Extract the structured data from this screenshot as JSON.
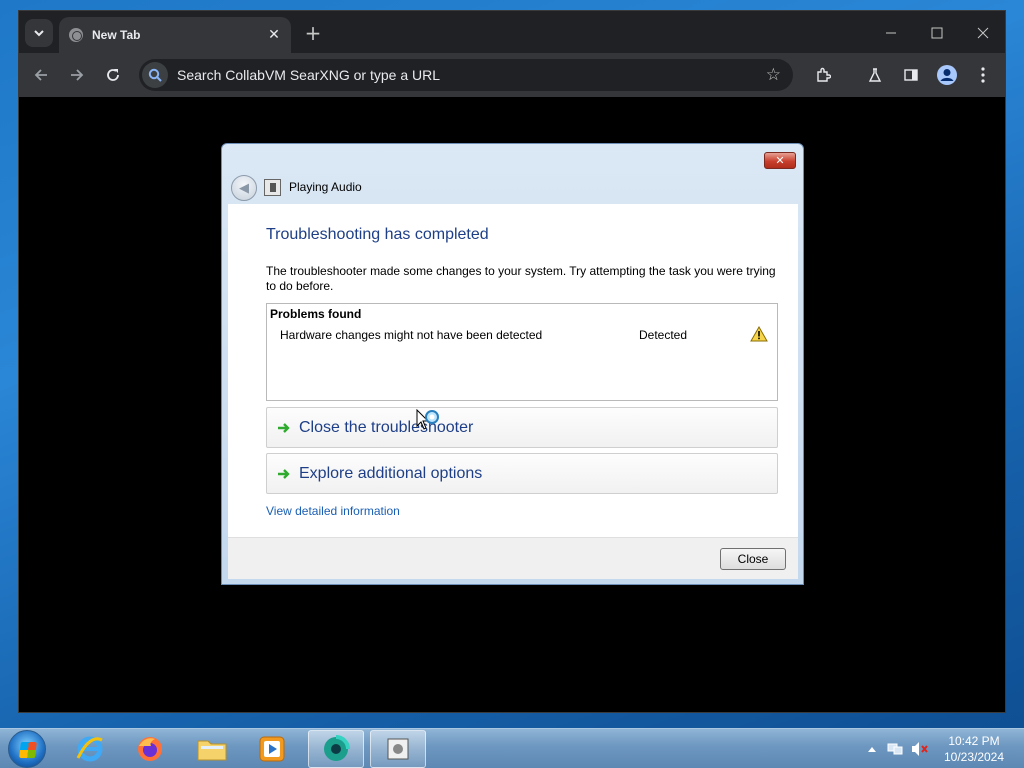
{
  "browser": {
    "tab_title": "New Tab",
    "omnibox_placeholder": "Search CollabVM SearXNG or type a URL"
  },
  "dialog": {
    "title": "Playing Audio",
    "close_glyph": "✕",
    "heading": "Troubleshooting has completed",
    "description": "The troubleshooter made some changes to your system. Try attempting the task you were trying to do before.",
    "problems_header": "Problems found",
    "problems": [
      {
        "name": "Hardware changes might not have been detected",
        "status": "Detected"
      }
    ],
    "options": [
      "Close the troubleshooter",
      "Explore additional options"
    ],
    "detail_link": "View detailed information",
    "close_button": "Close"
  },
  "taskbar": {
    "apps": [
      "internet-explorer",
      "firefox",
      "file-explorer",
      "windows-media-player",
      "chrome-canary",
      "troubleshooter"
    ],
    "time": "10:42 PM",
    "date": "10/23/2024"
  },
  "colors": {
    "chrome_tabstrip": "#202124",
    "chrome_toolbar": "#35363a",
    "dialog_heading": "#1e3f87",
    "link": "#1a5fb4"
  }
}
